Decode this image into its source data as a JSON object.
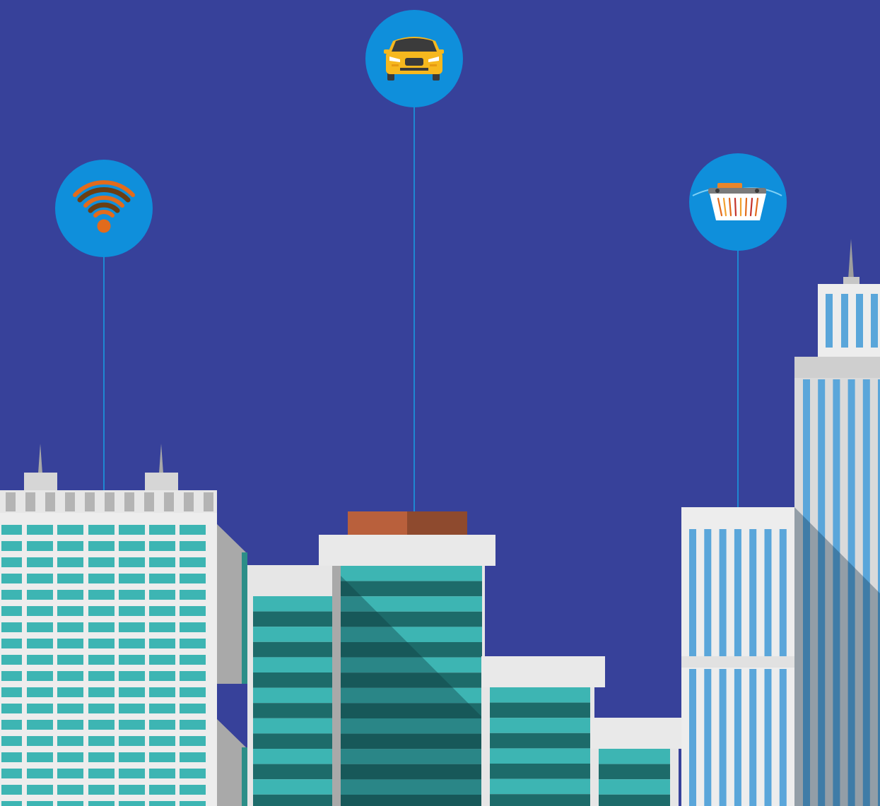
{
  "scene": {
    "background_color": "#37419A",
    "icon_circle_color": "#0F8FDB",
    "connector_color": "#1E88D2"
  },
  "icons": [
    {
      "name": "wifi-icon",
      "meaning": "connectivity"
    },
    {
      "name": "car-icon",
      "meaning": "vehicle"
    },
    {
      "name": "basket-icon",
      "meaning": "shopping"
    }
  ],
  "buildings": {
    "teal_glass": "#3DB5B3",
    "teal_dark": "#1D6B6A",
    "white_facade": "#E9E9E9",
    "grey_side": "#A9A9A9",
    "blue_glass": "#5AA6DA",
    "roof_brick": "#B9603C"
  }
}
